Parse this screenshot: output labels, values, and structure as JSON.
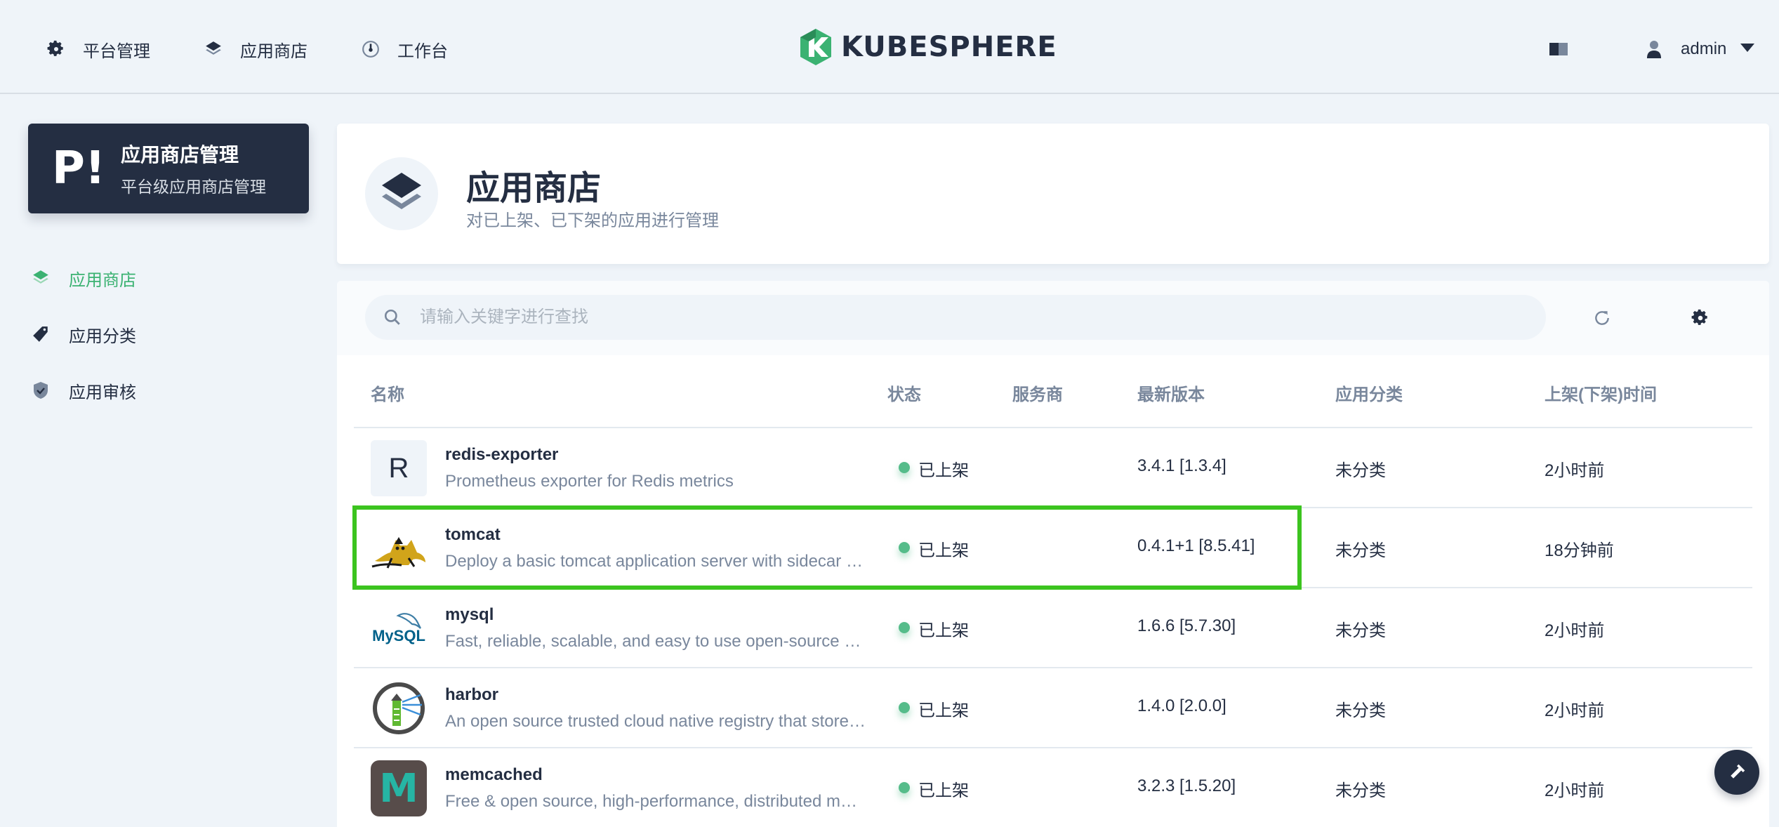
{
  "topnav": {
    "items": [
      {
        "label": "平台管理",
        "icon": "gear-icon"
      },
      {
        "label": "应用商店",
        "icon": "layers-icon"
      },
      {
        "label": "工作台",
        "icon": "dashboard-icon"
      }
    ],
    "logo_text": "KUBESPHERE",
    "user": "admin"
  },
  "sidebar": {
    "card_badge": "P!",
    "card_title": "应用商店管理",
    "card_subtitle": "平台级应用商店管理",
    "items": [
      {
        "label": "应用商店",
        "icon": "layers-icon",
        "active": true
      },
      {
        "label": "应用分类",
        "icon": "tag-icon",
        "active": false
      },
      {
        "label": "应用审核",
        "icon": "shield-icon",
        "active": false
      }
    ]
  },
  "header": {
    "title": "应用商店",
    "description": "对已上架、已下架的应用进行管理"
  },
  "search": {
    "placeholder": "请输入关键字进行查找"
  },
  "table": {
    "columns": [
      "名称",
      "状态",
      "服务商",
      "最新版本",
      "应用分类",
      "上架(下架)时间"
    ],
    "rows": [
      {
        "name": "redis-exporter",
        "desc": "Prometheus exporter for Redis metrics",
        "status": "已上架",
        "provider": "",
        "version": "3.4.1 [1.3.4]",
        "category": "未分类",
        "time": "2小时前",
        "logo": "R"
      },
      {
        "name": "tomcat",
        "desc": "Deploy a basic tomcat application server with sidecar as web archive container",
        "status": "已上架",
        "provider": "",
        "version": "0.4.1+1 [8.5.41]",
        "category": "未分类",
        "time": "18分钟前",
        "logo": ""
      },
      {
        "name": "mysql",
        "desc": "Fast, reliable, scalable, and easy to use open-source relational database system.",
        "status": "已上架",
        "provider": "",
        "version": "1.6.6 [5.7.30]",
        "category": "未分类",
        "time": "2小时前",
        "logo": "MySQL"
      },
      {
        "name": "harbor",
        "desc": "An open source trusted cloud native registry that stores, signs, and scans content",
        "status": "已上架",
        "provider": "",
        "version": "1.4.0 [2.0.0]",
        "category": "未分类",
        "time": "2小时前",
        "logo": ""
      },
      {
        "name": "memcached",
        "desc": "Free & open source, high-performance, distributed memory object caching system.",
        "status": "已上架",
        "provider": "",
        "version": "3.2.3 [1.5.20]",
        "category": "未分类",
        "time": "2小时前",
        "logo": "M"
      }
    ]
  },
  "colors": {
    "accent": "#3bb272",
    "dark": "#242e42",
    "highlight": "#3cc41f"
  }
}
